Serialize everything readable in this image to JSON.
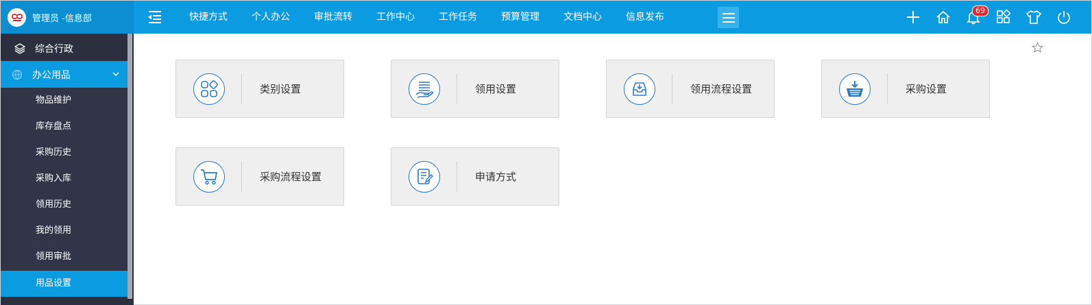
{
  "header": {
    "user_label": "管理员 -信息部",
    "nav": [
      "快捷方式",
      "个人办公",
      "审批流转",
      "工作中心",
      "工作任务",
      "预算管理",
      "文档中心",
      "信息发布"
    ],
    "notification_count": "69"
  },
  "sidebar": {
    "group1": "综合行政",
    "group2": "办公用品",
    "items": [
      "物品维护",
      "库存盘点",
      "采购历史",
      "采购入库",
      "领用历史",
      "我的领用",
      "领用审批",
      "用品设置"
    ],
    "active_item": "用品设置"
  },
  "cards": [
    {
      "label": "类别设置",
      "icon": "category-grid-icon"
    },
    {
      "label": "领用设置",
      "icon": "hand-list-icon"
    },
    {
      "label": "领用流程设置",
      "icon": "inbox-download-icon"
    },
    {
      "label": "采购设置",
      "icon": "basket-download-icon"
    },
    {
      "label": "采购流程设置",
      "icon": "shopping-cart-icon"
    },
    {
      "label": "申请方式",
      "icon": "document-edit-icon"
    }
  ],
  "colors": {
    "primary": "#0a9be0",
    "sidebar_bg": "#2b2f3e",
    "icon_stroke": "#2a7bc6",
    "badge": "#e5262b"
  }
}
